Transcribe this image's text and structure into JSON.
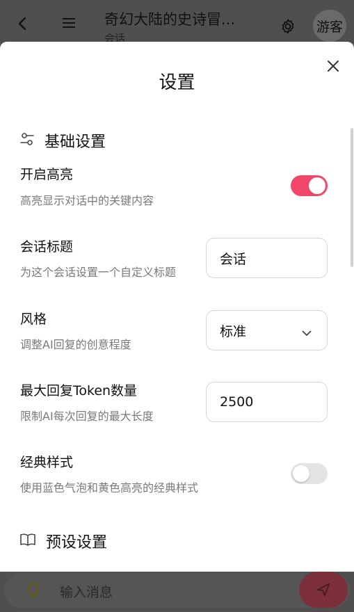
{
  "topbar": {
    "title": "奇幻大陆的史诗冒...",
    "subtitle": "会话",
    "guest_label": "游客"
  },
  "modal": {
    "title": "设置",
    "basic_section": {
      "title": "基础设置"
    },
    "highlight": {
      "title": "开启高亮",
      "desc": "高亮显示对话中的关键内容",
      "enabled": true
    },
    "session_title": {
      "title": "会话标题",
      "desc": "为这个会话设置一个自定义标题",
      "value": "会话"
    },
    "style": {
      "title": "风格",
      "desc": "调整AI回复的创意程度",
      "selected": "标准"
    },
    "max_tokens": {
      "title": "最大回复Token数量",
      "desc": "限制AI每次回复的最大长度",
      "value": "2500"
    },
    "classic_style": {
      "title": "经典样式",
      "desc": "使用蓝色气泡和黄色高亮的经典样式",
      "enabled": false
    },
    "preset_section": {
      "title": "预设设置"
    }
  },
  "bottombar": {
    "input_placeholder": "输入消息"
  },
  "colors": {
    "accent": "#f0476a",
    "overlay": "#4f4f4f",
    "send_dim": "#7a2f3a"
  }
}
